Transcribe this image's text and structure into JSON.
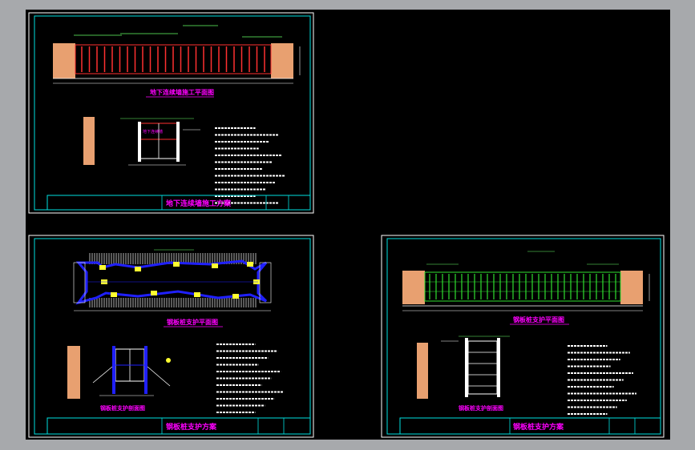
{
  "colors": {
    "frame_outer": "#ffffff",
    "frame_inner": "#00e0e0",
    "title_text": "#ff00ff",
    "background": "#000000",
    "app_bg": "#a7a9ac",
    "soil": "#e8a070",
    "pile_red": "#ff3030",
    "pile_green": "#30e030",
    "pile_yellow": "#ffff30",
    "wall_blue": "#2020ff",
    "dim_cyan": "#00ffff",
    "label_green": "#66ff66",
    "note_text": "#ffffff"
  },
  "sheets": {
    "top_left": {
      "plan_title": "地下连续墙施工平面图",
      "section_title": "地下连续墙",
      "title_block": "地下连续墙施工方案"
    },
    "bottom_left": {
      "plan_title": "钢板桩支护平面图",
      "section_title": "钢板桩支护剖面图",
      "title_block": "钢板桩支护方案"
    },
    "bottom_right": {
      "plan_title": "钢板桩支护平面图",
      "section_title": "钢板桩支护剖面图",
      "title_block": "钢板桩支护方案"
    }
  }
}
